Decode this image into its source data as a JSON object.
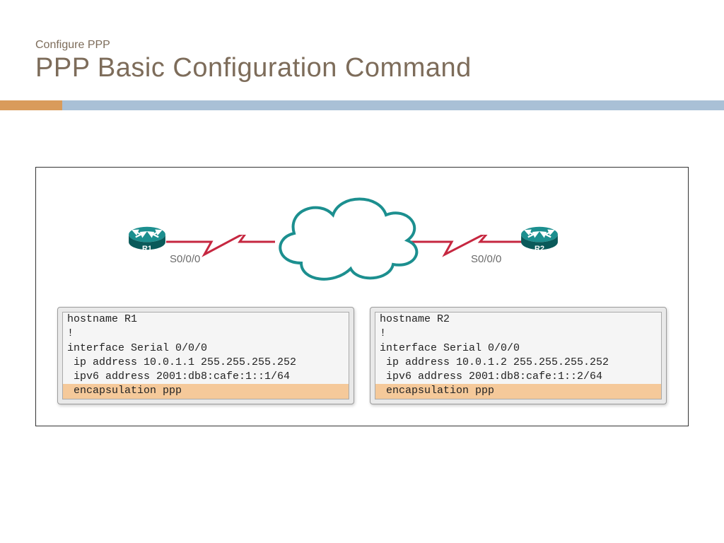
{
  "header": {
    "subtitle": "Configure PPP",
    "title": "PPP Basic Configuration Command"
  },
  "topology": {
    "router1": {
      "label": "R1",
      "interface": "S0/0/0"
    },
    "router2": {
      "label": "R2",
      "interface": "S0/0/0"
    }
  },
  "configs": {
    "left": {
      "l1": "hostname R1",
      "l2": "!",
      "l3": "interface Serial 0/0/0",
      "l4": " ip address 10.0.1.1 255.255.255.252",
      "l5": " ipv6 address 2001:db8:cafe:1::1/64",
      "l6": " encapsulation ppp"
    },
    "right": {
      "l1": "hostname R2",
      "l2": "!",
      "l3": "interface Serial 0/0/0",
      "l4": " ip address 10.0.1.2 255.255.255.252",
      "l5": " ipv6 address 2001:db8:cafe:1::2/64",
      "l6": " encapsulation ppp"
    }
  },
  "colors": {
    "accent": "#d99b5b",
    "bar": "#a9c0d6",
    "routerTop": "#1c8f8f",
    "routerDark": "#0a5a5a",
    "wire": "#c62740",
    "highlight": "#f5c99a"
  }
}
